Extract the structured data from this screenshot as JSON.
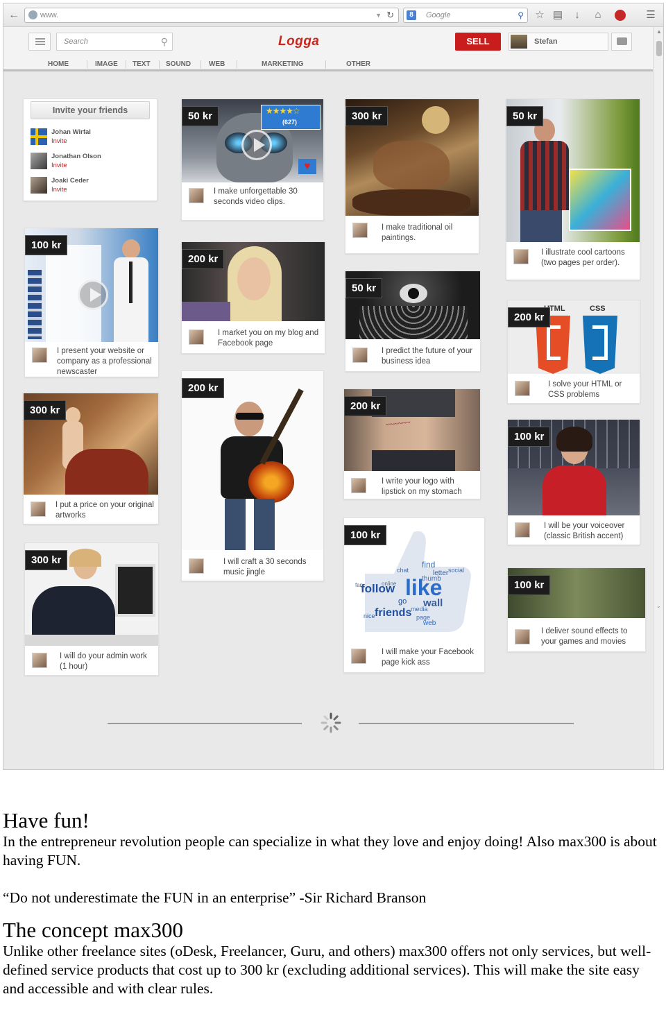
{
  "browser": {
    "url": "www.",
    "search_placeholder": "Google",
    "search_engine_icon": "google-g-icon"
  },
  "site": {
    "search_placeholder": "Search",
    "logo": "Logga",
    "sell_label": "SELL",
    "user_name": "Stefan",
    "categories": [
      "HOME",
      "IMAGE",
      "TEXT",
      "SOUND",
      "WEB",
      "MARKETING",
      "OTHER"
    ]
  },
  "invite": {
    "button_label": "Invite your friends",
    "friends": [
      {
        "name": "Johan Wirfal",
        "action": "Invite"
      },
      {
        "name": "Jonathan Olson",
        "action": "Invite"
      },
      {
        "name": "Joaki Ceder",
        "action": "Invite"
      }
    ]
  },
  "listings": [
    {
      "price": "50 kr",
      "title": "I make unforgettable 30 seconds video clips.",
      "rating_count": "(627)",
      "rating_stars": 5
    },
    {
      "price": "100 kr",
      "title": "I present your website or company as a professional newscaster"
    },
    {
      "price": "300 kr",
      "title": "I put a price on your original artworks"
    },
    {
      "price": "300 kr",
      "title": "I will do your admin work (1 hour)"
    },
    {
      "price": "200 kr",
      "title": "I market you on my blog and Facebook page"
    },
    {
      "price": "200 kr",
      "title": "I will craft a 30 seconds music jingle"
    },
    {
      "price": "300 kr",
      "title": "I make traditional oil paintings."
    },
    {
      "price": "50 kr",
      "title": "I predict the future of your business idea"
    },
    {
      "price": "200 kr",
      "title": "I write your logo with lipstick on my stomach"
    },
    {
      "price": "100 kr",
      "title": "I will make your Facebook page kick ass",
      "image_words": [
        "follow",
        "like",
        "friends",
        "wall",
        "thumb",
        "find",
        "social",
        "letter",
        "chat",
        "online",
        "media",
        "go",
        "page",
        "web",
        "nice",
        "fan"
      ]
    },
    {
      "price": "50 kr",
      "title": "I illustrate cool cartoons (two pages per order)."
    },
    {
      "price": "200 kr",
      "title": "I solve your HTML or CSS problems",
      "image_words": [
        "HTML",
        "CSS"
      ]
    },
    {
      "price": "100 kr",
      "title": "I will be your voiceover (classic British accent)"
    },
    {
      "price": "100 kr",
      "title": "I deliver sound effects to your games and movies"
    }
  ],
  "article": {
    "heading1": "Have fun!",
    "para1": "In the entrepreneur revolution people can specialize in what they love and enjoy doing! Also max300 is about having FUN.",
    "quote": "“Do not underestimate the FUN in an enterprise”  -Sir Richard Branson",
    "heading2": "The concept max300",
    "para2": "Unlike other freelance sites (oDesk, Freelancer, Guru, and others) max300 offers not only services, but well-defined service products that cost up to 300 kr (excluding additional services). This will make the site easy and accessible and with clear rules."
  },
  "colors": {
    "accent_red": "#c91d1d",
    "logo_red": "#c8281e",
    "price_tag_bg": "#1c1c1c",
    "page_bg": "#e9e9e9"
  }
}
